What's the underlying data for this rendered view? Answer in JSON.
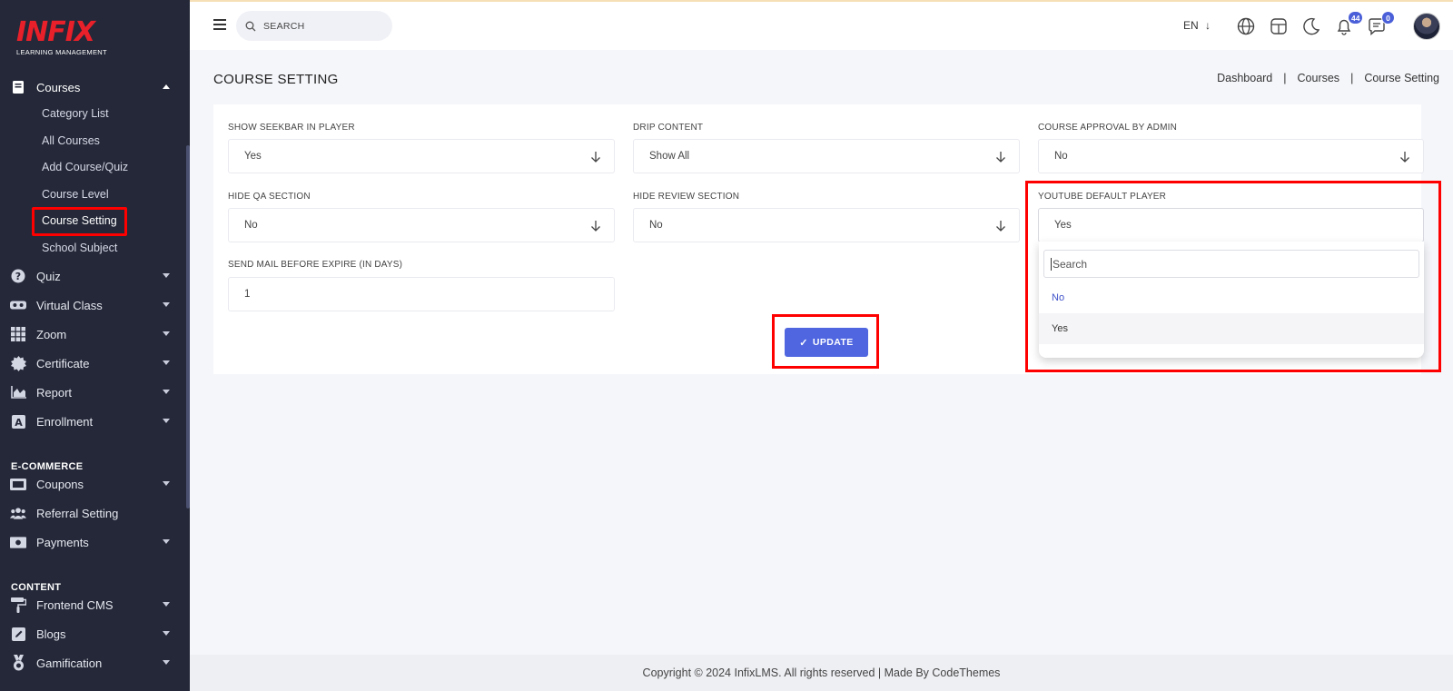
{
  "brand": {
    "name": "INFIX",
    "tagline": "LEARNING MANAGEMENT"
  },
  "sidebar": {
    "courses_label": "Courses",
    "submenu": [
      "Category List",
      "All Courses",
      "Add Course/Quiz",
      "Course Level",
      "Course Setting",
      "School Subject"
    ],
    "items": [
      "Quiz",
      "Virtual Class",
      "Zoom",
      "Certificate",
      "Report",
      "Enrollment"
    ],
    "section_ecommerce": "E-COMMERCE",
    "ecommerce": [
      "Coupons",
      "Referral Setting",
      "Payments"
    ],
    "section_content": "CONTENT",
    "content": [
      "Frontend CMS",
      "Blogs",
      "Gamification"
    ]
  },
  "topbar": {
    "search_placeholder": "SEARCH",
    "language": "EN",
    "notifications_count": "44",
    "messages_count": "0"
  },
  "page": {
    "title": "COURSE SETTING",
    "breadcrumb": [
      "Dashboard",
      "Courses",
      "Course Setting"
    ]
  },
  "form": {
    "show_seekbar": {
      "label": "SHOW SEEKBAR IN PLAYER",
      "value": "Yes"
    },
    "drip_content": {
      "label": "DRIP CONTENT",
      "value": "Show All"
    },
    "course_approval": {
      "label": "COURSE APPROVAL BY ADMIN",
      "value": "No"
    },
    "hide_qa": {
      "label": "HIDE QA SECTION",
      "value": "No"
    },
    "hide_review": {
      "label": "HIDE REVIEW SECTION",
      "value": "No"
    },
    "youtube_player": {
      "label": "YOUTUBE DEFAULT PLAYER",
      "value": "Yes",
      "search_placeholder": "Search",
      "options": [
        "No",
        "Yes"
      ]
    },
    "send_mail": {
      "label": "SEND MAIL BEFORE EXPIRE (IN DAYS)",
      "value": "1"
    },
    "update_label": "UPDATE"
  },
  "footer": {
    "text": "Copyright © 2024 InfixLMS. All rights reserved | Made By CodeThemes"
  },
  "colors": {
    "sidebar_bg": "#242838",
    "accent": "#4f66e0",
    "highlight": "#ff0000",
    "brand_red": "#e8202a"
  }
}
